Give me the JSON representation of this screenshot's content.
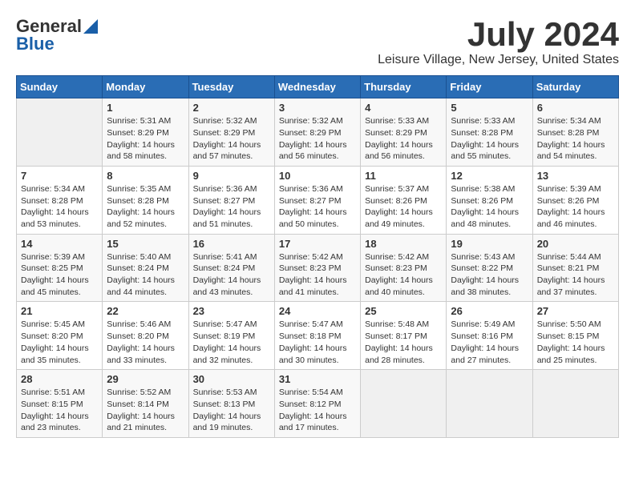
{
  "logo": {
    "general": "General",
    "blue": "Blue"
  },
  "title": {
    "month_year": "July 2024",
    "location": "Leisure Village, New Jersey, United States"
  },
  "weekdays": [
    "Sunday",
    "Monday",
    "Tuesday",
    "Wednesday",
    "Thursday",
    "Friday",
    "Saturday"
  ],
  "weeks": [
    [
      {
        "day": "",
        "info": ""
      },
      {
        "day": "1",
        "info": "Sunrise: 5:31 AM\nSunset: 8:29 PM\nDaylight: 14 hours\nand 58 minutes."
      },
      {
        "day": "2",
        "info": "Sunrise: 5:32 AM\nSunset: 8:29 PM\nDaylight: 14 hours\nand 57 minutes."
      },
      {
        "day": "3",
        "info": "Sunrise: 5:32 AM\nSunset: 8:29 PM\nDaylight: 14 hours\nand 56 minutes."
      },
      {
        "day": "4",
        "info": "Sunrise: 5:33 AM\nSunset: 8:29 PM\nDaylight: 14 hours\nand 56 minutes."
      },
      {
        "day": "5",
        "info": "Sunrise: 5:33 AM\nSunset: 8:28 PM\nDaylight: 14 hours\nand 55 minutes."
      },
      {
        "day": "6",
        "info": "Sunrise: 5:34 AM\nSunset: 8:28 PM\nDaylight: 14 hours\nand 54 minutes."
      }
    ],
    [
      {
        "day": "7",
        "info": "Sunrise: 5:34 AM\nSunset: 8:28 PM\nDaylight: 14 hours\nand 53 minutes."
      },
      {
        "day": "8",
        "info": "Sunrise: 5:35 AM\nSunset: 8:28 PM\nDaylight: 14 hours\nand 52 minutes."
      },
      {
        "day": "9",
        "info": "Sunrise: 5:36 AM\nSunset: 8:27 PM\nDaylight: 14 hours\nand 51 minutes."
      },
      {
        "day": "10",
        "info": "Sunrise: 5:36 AM\nSunset: 8:27 PM\nDaylight: 14 hours\nand 50 minutes."
      },
      {
        "day": "11",
        "info": "Sunrise: 5:37 AM\nSunset: 8:26 PM\nDaylight: 14 hours\nand 49 minutes."
      },
      {
        "day": "12",
        "info": "Sunrise: 5:38 AM\nSunset: 8:26 PM\nDaylight: 14 hours\nand 48 minutes."
      },
      {
        "day": "13",
        "info": "Sunrise: 5:39 AM\nSunset: 8:26 PM\nDaylight: 14 hours\nand 46 minutes."
      }
    ],
    [
      {
        "day": "14",
        "info": "Sunrise: 5:39 AM\nSunset: 8:25 PM\nDaylight: 14 hours\nand 45 minutes."
      },
      {
        "day": "15",
        "info": "Sunrise: 5:40 AM\nSunset: 8:24 PM\nDaylight: 14 hours\nand 44 minutes."
      },
      {
        "day": "16",
        "info": "Sunrise: 5:41 AM\nSunset: 8:24 PM\nDaylight: 14 hours\nand 43 minutes."
      },
      {
        "day": "17",
        "info": "Sunrise: 5:42 AM\nSunset: 8:23 PM\nDaylight: 14 hours\nand 41 minutes."
      },
      {
        "day": "18",
        "info": "Sunrise: 5:42 AM\nSunset: 8:23 PM\nDaylight: 14 hours\nand 40 minutes."
      },
      {
        "day": "19",
        "info": "Sunrise: 5:43 AM\nSunset: 8:22 PM\nDaylight: 14 hours\nand 38 minutes."
      },
      {
        "day": "20",
        "info": "Sunrise: 5:44 AM\nSunset: 8:21 PM\nDaylight: 14 hours\nand 37 minutes."
      }
    ],
    [
      {
        "day": "21",
        "info": "Sunrise: 5:45 AM\nSunset: 8:20 PM\nDaylight: 14 hours\nand 35 minutes."
      },
      {
        "day": "22",
        "info": "Sunrise: 5:46 AM\nSunset: 8:20 PM\nDaylight: 14 hours\nand 33 minutes."
      },
      {
        "day": "23",
        "info": "Sunrise: 5:47 AM\nSunset: 8:19 PM\nDaylight: 14 hours\nand 32 minutes."
      },
      {
        "day": "24",
        "info": "Sunrise: 5:47 AM\nSunset: 8:18 PM\nDaylight: 14 hours\nand 30 minutes."
      },
      {
        "day": "25",
        "info": "Sunrise: 5:48 AM\nSunset: 8:17 PM\nDaylight: 14 hours\nand 28 minutes."
      },
      {
        "day": "26",
        "info": "Sunrise: 5:49 AM\nSunset: 8:16 PM\nDaylight: 14 hours\nand 27 minutes."
      },
      {
        "day": "27",
        "info": "Sunrise: 5:50 AM\nSunset: 8:15 PM\nDaylight: 14 hours\nand 25 minutes."
      }
    ],
    [
      {
        "day": "28",
        "info": "Sunrise: 5:51 AM\nSunset: 8:15 PM\nDaylight: 14 hours\nand 23 minutes."
      },
      {
        "day": "29",
        "info": "Sunrise: 5:52 AM\nSunset: 8:14 PM\nDaylight: 14 hours\nand 21 minutes."
      },
      {
        "day": "30",
        "info": "Sunrise: 5:53 AM\nSunset: 8:13 PM\nDaylight: 14 hours\nand 19 minutes."
      },
      {
        "day": "31",
        "info": "Sunrise: 5:54 AM\nSunset: 8:12 PM\nDaylight: 14 hours\nand 17 minutes."
      },
      {
        "day": "",
        "info": ""
      },
      {
        "day": "",
        "info": ""
      },
      {
        "day": "",
        "info": ""
      }
    ]
  ]
}
